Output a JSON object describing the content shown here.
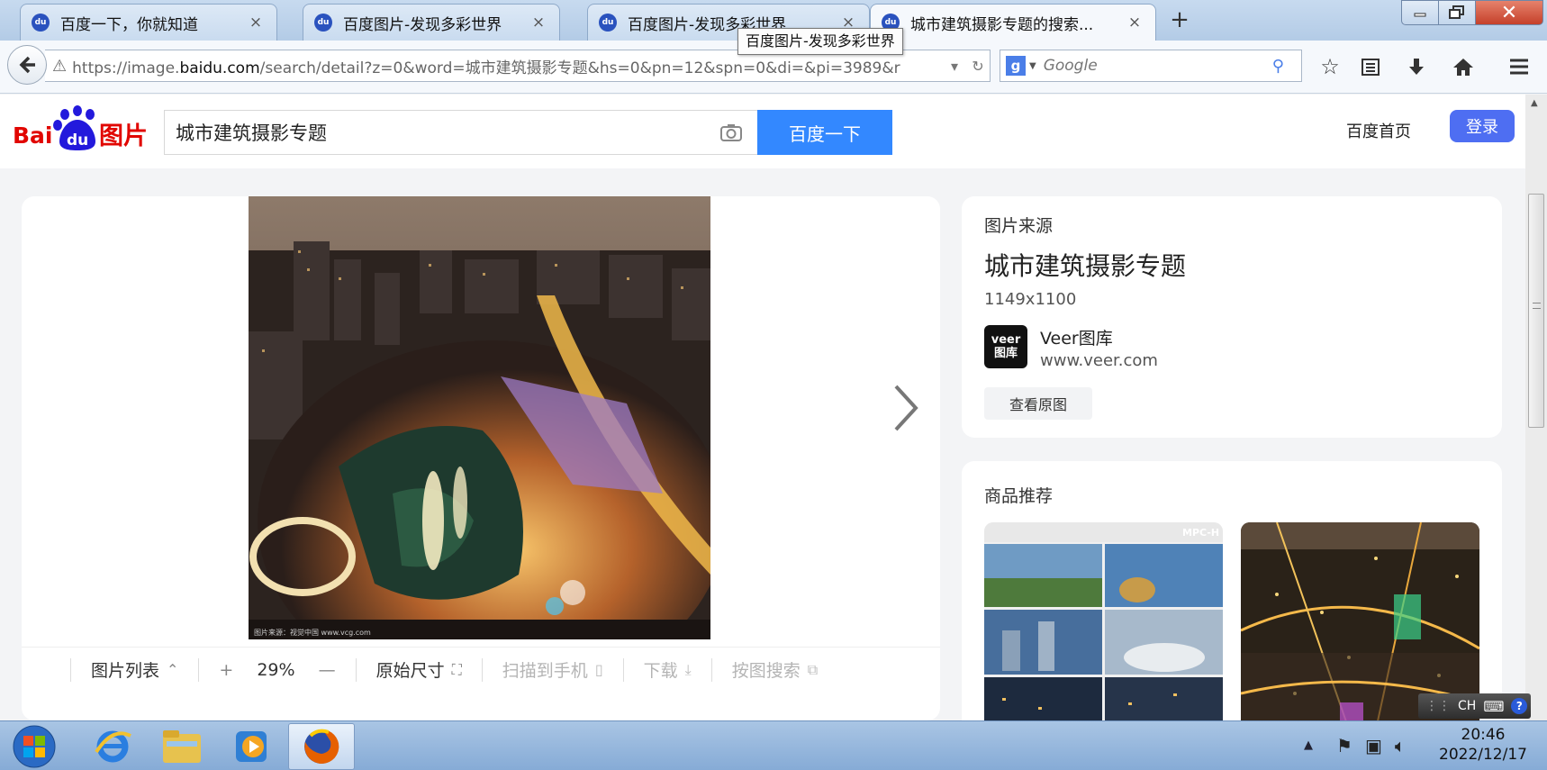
{
  "browser": {
    "tabs": [
      {
        "label": "百度一下，你就知道"
      },
      {
        "label": "百度图片-发现多彩世界"
      },
      {
        "label": "百度图片-发现多彩世界"
      },
      {
        "label": "城市建筑摄影专题的搜索..."
      }
    ],
    "tab_close_glyph": "×",
    "new_tab_glyph": "+",
    "tooltip": "百度图片-发现多彩世界",
    "url_prefix": "https://image.",
    "url_domain": "baidu.com",
    "url_rest": "/search/detail?z=0&word=城市建筑摄影专题&hs=0&pn=12&spn=0&di=&pi=3989&r",
    "search_placeholder": "Google",
    "search_engine_letter": "g"
  },
  "page": {
    "search_value": "城市建筑摄影专题",
    "search_button": "百度一下",
    "nav_home": "百度首页",
    "login": "登录",
    "logo_text_bai": "Bai",
    "logo_text_du": "du",
    "logo_text_pic": "图片"
  },
  "viewer": {
    "photo_caption": "图片来源：视觉中国 www.vcg.com",
    "toolbar": {
      "list": "图片列表",
      "zoom_in": "+",
      "zoom": "29%",
      "zoom_out": "—",
      "original_size": "原始尺寸",
      "scan_to_phone": "扫描到手机",
      "download": "下载",
      "search_by_image": "按图搜索"
    }
  },
  "source": {
    "heading": "图片来源",
    "title": "城市建筑摄影专题",
    "size": "1149x1100",
    "logo_line1": "veer",
    "logo_line2": "图库",
    "name": "Veer图库",
    "domain": "www.veer.com",
    "view_original": "查看原图"
  },
  "goods": {
    "heading": "商品推荐",
    "badge": "MPC-H"
  },
  "taskbar": {
    "ime": "CH",
    "time": "20:46",
    "date": "2022/12/17"
  },
  "colors": {
    "baidu_blue": "#3388ff",
    "login_blue": "#4e6ef2",
    "logo_red": "#e10601",
    "logo_blue": "#2319dc"
  }
}
